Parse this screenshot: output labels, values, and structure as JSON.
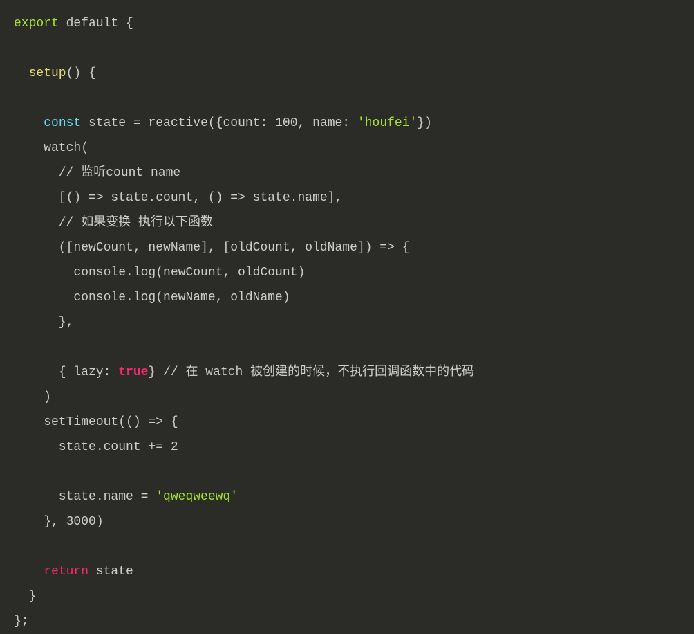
{
  "code": {
    "line1_export": "export",
    "line1_default": " default",
    "line1_brace": " {",
    "line2_empty": "",
    "line3_setup": "  setup",
    "line3_rest": "() {",
    "line4_empty": "",
    "line5_indent": "    ",
    "line5_const": "const",
    "line5_state": " state = reactive({count: ",
    "line5_num": "100",
    "line5_name": ", name: ",
    "line5_str": "'houfei'",
    "line5_end": "})",
    "line6_empty": "",
    "line7": "    watch(",
    "line8_indent": "      ",
    "line8_comment": "// 监听count name",
    "line9_empty": "",
    "line10": "      [() => state.count, () => state.name],",
    "line11_indent": "      ",
    "line11_comment": "// 如果变换 执行以下函数",
    "line12_empty": "",
    "line13": "      ([newCount, newName], [oldCount, oldName]) => {",
    "line14": "        console.log(newCount, oldCount)",
    "line15": "        console.log(newName, oldName)",
    "line16": "      },",
    "line17_empty": "",
    "line18_indent": "      { lazy: ",
    "line18_true": "true",
    "line18_brace": "} ",
    "line18_comment": "// 在 watch 被创建的时候，不执行回调函数中的代码",
    "line19_empty": "",
    "line20": "    )",
    "line21": "    setTimeout(() => {",
    "line22_indent": "      state.count += ",
    "line22_num": "2",
    "line23_empty": "",
    "line24_indent": "      state.name = ",
    "line24_str": "'qweqweewq'",
    "line25_empty": "",
    "line26_indent": "    }, ",
    "line26_num": "3000",
    "line26_end": ")",
    "line27_empty": "",
    "line28_indent": "    ",
    "line28_return": "return",
    "line28_state": " state",
    "line29_empty": "",
    "line30": "  }",
    "line31": "};"
  }
}
